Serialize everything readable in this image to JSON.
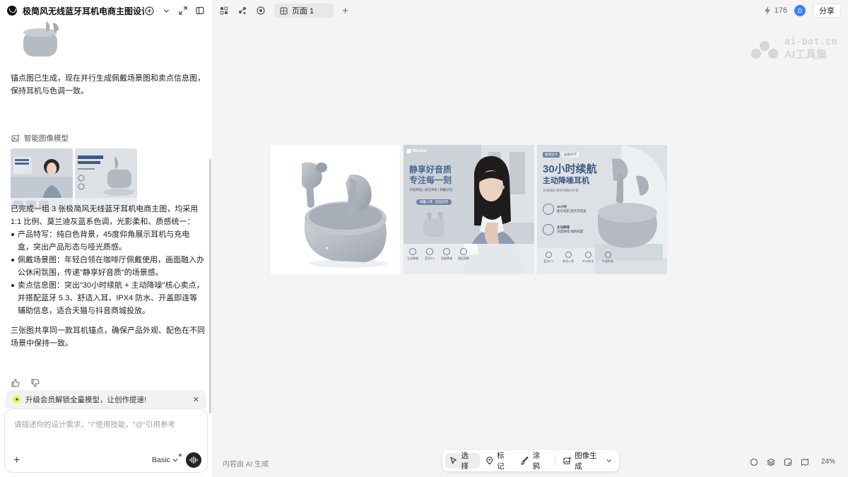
{
  "app": {
    "project_title": "极简风无线蓝牙耳机电商主图设计",
    "page_tab": "页面 1",
    "credits": "176",
    "avatar_text": "D",
    "share_label": "分享"
  },
  "chat": {
    "msg1": "锚点图已生成，现在并行生成佩戴场景图和卖点信息图，保持耳机与色调一致。",
    "model_label": "智能图像模型",
    "msg2": "已完成一组 3 张极简风无线蓝牙耳机电商主图，均采用 1:1 比例、莫兰迪灰蓝系色调，光影柔和、质感统一：",
    "bullets": [
      "产品特写：纯白色背景，45度仰角展示耳机与充电盒，突出产品形态与哑光质感。",
      "佩戴场景图：年轻白领在咖啡厅佩戴使用，画面融入办公休闲氛围，传递\"静享好音质\"的场景感。",
      "卖点信息图：突出\"30小时续航 + 主动降噪\"核心卖点，并搭配蓝牙 5.3、舒适入耳、IPX4 防水、开盖即连等辅助信息，适合天猫与抖音商城投放。"
    ],
    "msg3": "三张图共享同一款耳机锚点，确保产品外观、配色在不同场景中保持一致。"
  },
  "input": {
    "upgrade_text": "升级会员解锁全量模型，让创作提速!",
    "placeholder": "请描述你的设计需求，\"/\"使用技能，\"@\"引用参考",
    "mode": "Basic"
  },
  "canvas": {
    "watermark_line1": "ai-bot.cn",
    "watermark_line2": "AI工具集",
    "card2": {
      "brand": "Mireku",
      "title_line1": "静享好音质",
      "title_line2": "专注每一刻",
      "tags": "深度降噪 | 通话清晰 | 佩戴舒适",
      "badge": "佩戴入耳 · 轻盈舒适",
      "features": [
        "主动降噪",
        "蓝牙5.3",
        "深度降噪",
        "通话清晰"
      ]
    },
    "card3": {
      "badge_left": "极简设计",
      "badge_right": "品质声学",
      "title_line1": "30小时续航",
      "title_line2": "主动降噪耳机",
      "subtitle": "长效续航  静享纯粹好声音",
      "spec1_title": "30小时",
      "spec1_sub": "超长续航 配合充电盒",
      "spec2_title": "主动降噪",
      "spec2_sub": "深度降噪 隔绝喧嚣",
      "features": [
        "蓝牙5.3",
        "舒适入耳",
        "IPX4防水",
        "开盖即连"
      ]
    },
    "ai_note": "内容由 AI 生成",
    "zoom": "24%"
  },
  "toolbar": {
    "select": "选择",
    "mark": "标记",
    "paint": "涂鸦",
    "image_gen": "图像生成"
  },
  "colors": {
    "accent": "#3b82f6",
    "canvas_bg": "#f4f4f5",
    "product_gray": "#b9bec6",
    "title_blue": "#4a6a93"
  }
}
